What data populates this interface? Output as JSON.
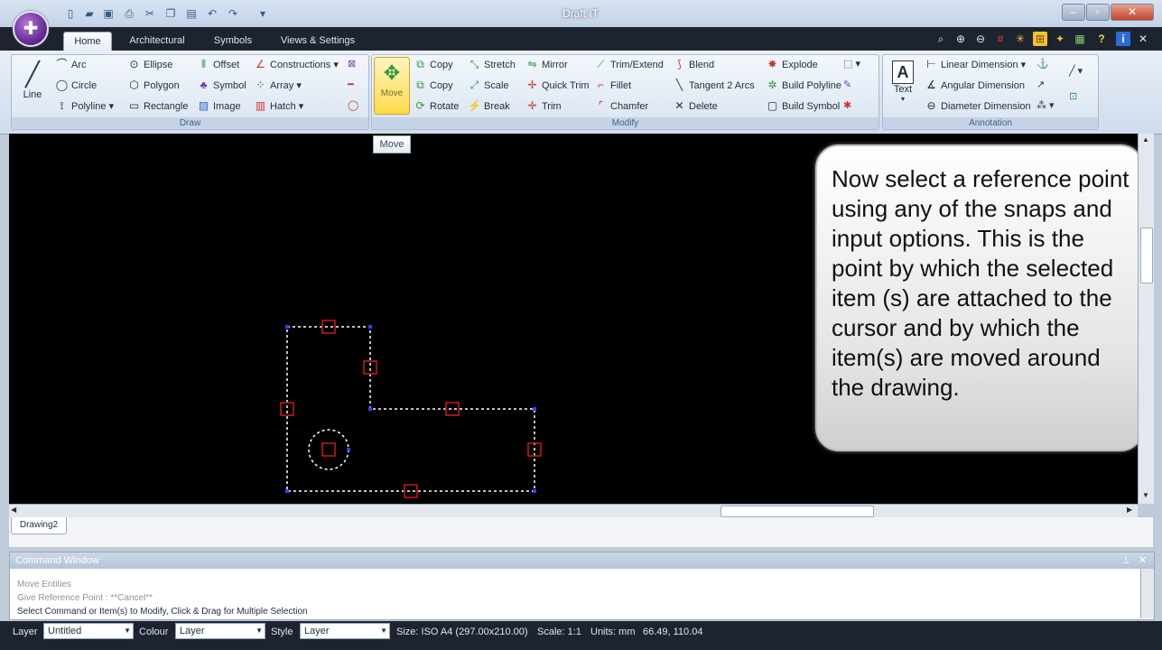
{
  "window": {
    "title": "Draft IT"
  },
  "tabs": [
    "Home",
    "Architectural",
    "Symbols",
    "Views & Settings"
  ],
  "draw_group": {
    "label": "Draw",
    "line": "Line",
    "col1": [
      "Arc",
      "Circle",
      "Polyline"
    ],
    "col2": [
      "Ellipse",
      "Polygon",
      "Rectangle"
    ],
    "col3": [
      "Offset",
      "Symbol",
      "Image"
    ],
    "col4": [
      "Constructions",
      "Array",
      "Hatch"
    ]
  },
  "modify_group": {
    "label": "Modify",
    "move": "Move",
    "col1": [
      "Copy",
      "Copy",
      "Rotate"
    ],
    "col2": [
      "Stretch",
      "Scale",
      "Break"
    ],
    "col3": [
      "Mirror",
      "Quick Trim",
      "Trim"
    ],
    "col4": [
      "Trim/Extend",
      "Fillet",
      "Chamfer"
    ],
    "col5": [
      "Blend",
      "Tangent 2 Arcs",
      "Delete"
    ],
    "col6": [
      "Explode",
      "Build Polyline",
      "Build Symbol"
    ]
  },
  "annotation_group": {
    "label": "Annotation",
    "text": "Text",
    "items": [
      "Linear Dimension",
      "Angular Dimension",
      "Diameter Dimension"
    ]
  },
  "tooltip": "Move",
  "callout": "Now select a reference point using any of the snaps and input options. This is the point by which the selected item (s) are attached to the cursor and by which the item(s) are moved around the drawing.",
  "drawing_tab": "Drawing2",
  "command_window": {
    "title": "Command Window",
    "lines": [
      "Move Entities",
      "Give Reference Point :  **Cancel**",
      "Select Command or Item(s) to Modify, Click & Drag for Multiple Selection"
    ]
  },
  "status": {
    "layer_label": "Layer",
    "layer_value": "Untitled",
    "colour_label": "Colour",
    "colour_value": "Layer",
    "style_label": "Style",
    "style_value": "Layer",
    "size": "Size: ISO A4 (297.00x210.00)",
    "scale": "Scale: 1:1",
    "units": "Units: mm",
    "coords": "66.49, 110.04"
  },
  "colors": {
    "canvas": "#000000",
    "selection_dots": "#ffffff",
    "snap_box": "#d01818",
    "accent_move": "#ffe66a"
  }
}
